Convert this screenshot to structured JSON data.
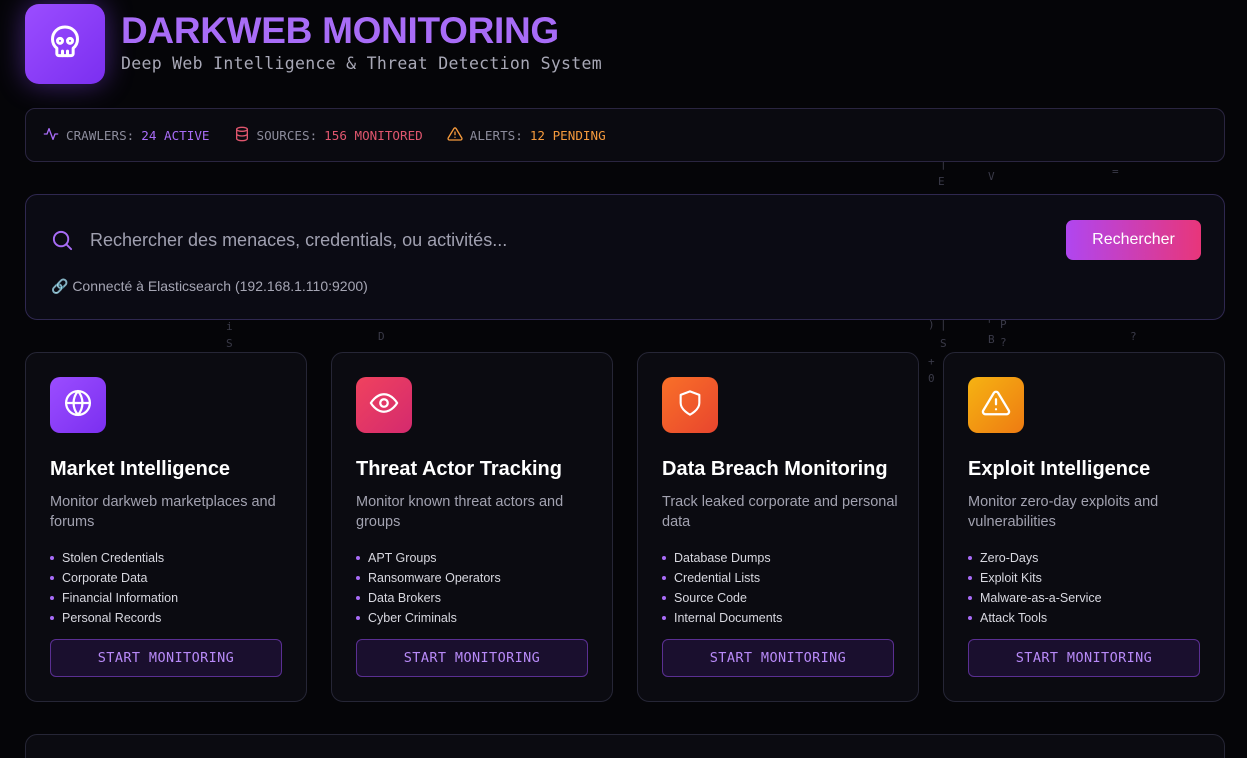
{
  "header": {
    "title": "DARKWEB MONITORING",
    "subtitle": "Deep Web Intelligence & Threat Detection System",
    "logo_icon": "skull-icon"
  },
  "status": [
    {
      "label": "CRAWLERS:",
      "value": "24 ACTIVE",
      "icon": "activity-icon",
      "color": "#a86cf7"
    },
    {
      "label": "SOURCES:",
      "value": "156 MONITORED",
      "icon": "database-icon",
      "color": "#e0566e"
    },
    {
      "label": "ALERTS:",
      "value": "12 PENDING",
      "icon": "alert-triangle-icon",
      "color": "#f59a3c"
    }
  ],
  "search": {
    "placeholder": "Rechercher des menaces, credentials, ou activités...",
    "button_label": "Rechercher",
    "connection_text": "🔗 Connecté à Elasticsearch (192.168.1.110:9200)"
  },
  "cards": [
    {
      "title": "Market Intelligence",
      "description": "Monitor darkweb marketplaces and forums",
      "items": [
        "Stolen Credentials",
        "Corporate Data",
        "Financial Information",
        "Personal Records"
      ],
      "button_label": "START MONITORING",
      "icon": "globe-icon",
      "gradient": [
        "#9b4dff",
        "#7b2ff0"
      ]
    },
    {
      "title": "Threat Actor Tracking",
      "description": "Monitor known threat actors and groups",
      "items": [
        "APT Groups",
        "Ransomware Operators",
        "Data Brokers",
        "Cyber Criminals"
      ],
      "button_label": "START MONITORING",
      "icon": "eye-icon",
      "gradient": [
        "#f0425e",
        "#d42a6e"
      ]
    },
    {
      "title": "Data Breach Monitoring",
      "description": "Track leaked corporate and personal data",
      "items": [
        "Database Dumps",
        "Credential Lists",
        "Source Code",
        "Internal Documents"
      ],
      "button_label": "START MONITORING",
      "icon": "shield-icon",
      "gradient": [
        "#f97028",
        "#e8452e"
      ]
    },
    {
      "title": "Exploit Intelligence",
      "description": "Monitor zero-day exploits and vulnerabilities",
      "items": [
        "Zero-Days",
        "Exploit Kits",
        "Malware-as-a-Service",
        "Attack Tools"
      ],
      "button_label": "START MONITORING",
      "icon": "alert-triangle-icon",
      "gradient": [
        "#f6b312",
        "#ee7b12"
      ]
    }
  ]
}
